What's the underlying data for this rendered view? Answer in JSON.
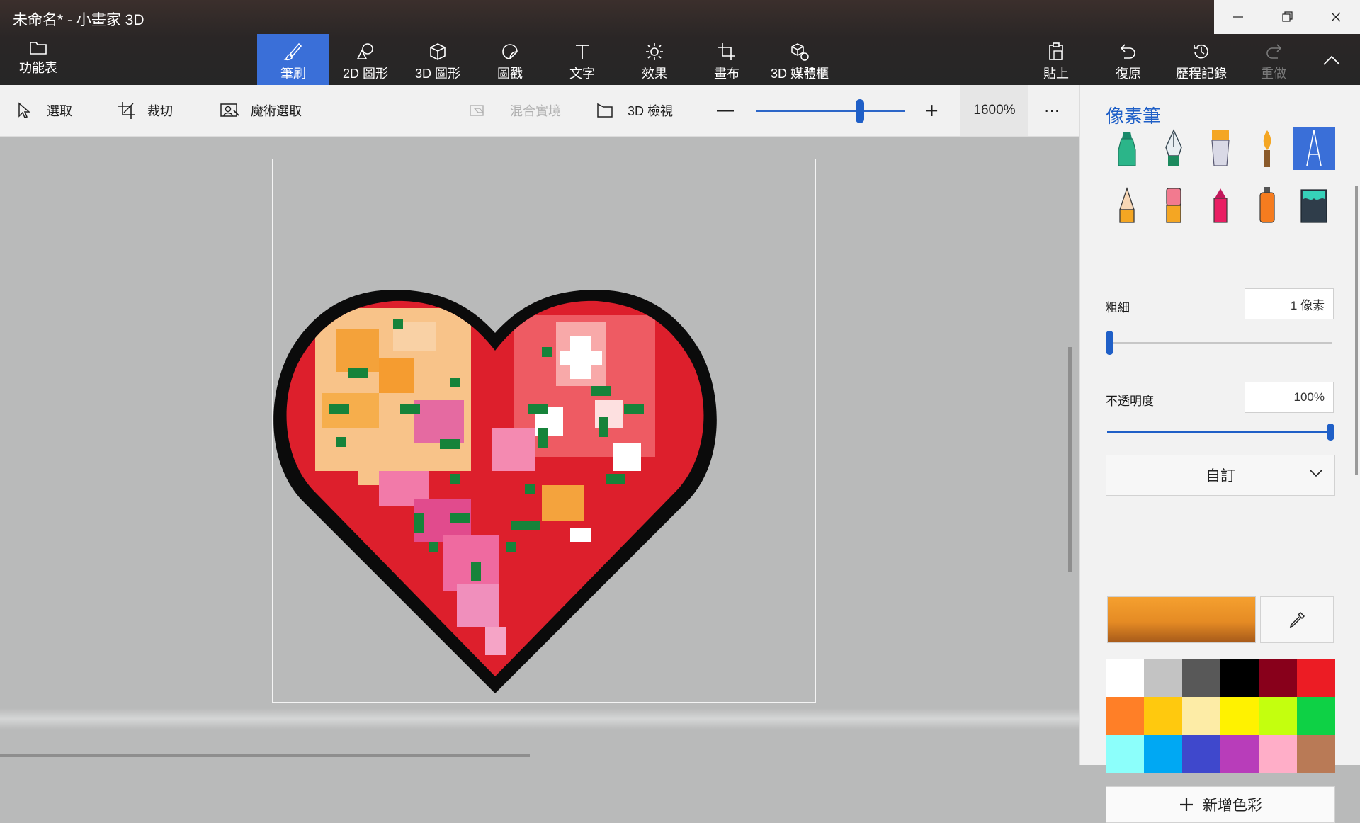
{
  "window": {
    "title": "未命名* - 小畫家 3D",
    "minimize_icon": "minimize-icon",
    "restore_icon": "restore-icon",
    "close_icon": "close-icon"
  },
  "ribbon": {
    "menu_label": "功能表",
    "tabs": [
      {
        "label": "筆刷",
        "icon": "brush-icon"
      },
      {
        "label": "2D 圖形",
        "icon": "2d-shapes-icon"
      },
      {
        "label": "3D 圖形",
        "icon": "3d-shapes-icon"
      },
      {
        "label": "圖戳",
        "icon": "sticker-icon"
      },
      {
        "label": "文字",
        "icon": "text-icon"
      },
      {
        "label": "效果",
        "icon": "effects-icon"
      },
      {
        "label": "畫布",
        "icon": "canvas-icon"
      },
      {
        "label": "3D 媒體櫃",
        "icon": "3d-library-icon"
      }
    ],
    "paste_label": "貼上",
    "undo_label": "復原",
    "history_label": "歷程記錄",
    "redo_label": "重做"
  },
  "toolbar": {
    "select_label": "選取",
    "crop_label": "裁切",
    "magic_select_label": "魔術選取",
    "mixed_reality_label": "混合實境",
    "view3d_label": "3D 檢視",
    "zoom_out": "—",
    "zoom_in": "+",
    "zoom_value": "1600%",
    "zoom_fraction": 0.66,
    "more": "···"
  },
  "panel": {
    "title": "像素筆",
    "brushes": [
      "marker",
      "calligraphy-pen",
      "oil-brush",
      "watercolor",
      "pixel-pen",
      "pencil",
      "eraser",
      "crayon",
      "spray-can",
      "fill"
    ],
    "selected_brush": "pixel-pen",
    "thickness_label": "粗細",
    "thickness_value": "1 像素",
    "thickness_fraction": 0.0,
    "opacity_label": "不透明度",
    "opacity_value": "100%",
    "opacity_fraction": 1.0,
    "texture_dropdown": "自訂",
    "current_color": "#e58b24",
    "palette": [
      "#ffffff",
      "#c3c3c3",
      "#585858",
      "#000000",
      "#88001b",
      "#ec1c24",
      "#ff7f27",
      "#ffc90e",
      "#fdeca6",
      "#fff200",
      "#c4ff0e",
      "#0ed145",
      "#8cfffb",
      "#00a8f3",
      "#3f48cc",
      "#b83dba",
      "#ffaec8",
      "#b97a56"
    ],
    "add_color_label": "新增色彩"
  }
}
